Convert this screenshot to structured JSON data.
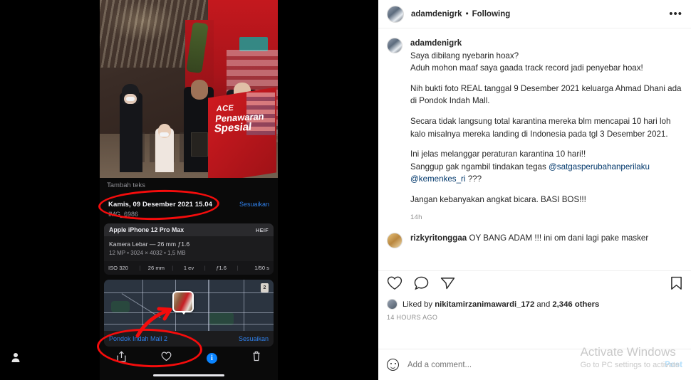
{
  "left_panel": {
    "photo": {
      "alt_description": "Family wearing masks standing inside a shopping mall",
      "banner_logo": "ACE",
      "banner_line1": "Penawaran",
      "banner_line2": "Spesial"
    },
    "add_text_label": "Tambah teks",
    "date_line": "Kamis, 09 Desember 2021 15.04",
    "filename": "IMG_6986",
    "adjust_label": "Sesuaikan",
    "exif": {
      "device": "Apple iPhone 12 Pro Max",
      "format": "HEIF",
      "lens_line": "Kamera Lebar — 26 mm ƒ1.6",
      "spec_line": "12 MP • 3024 × 4032 • 1,5 MB",
      "stats": [
        "ISO 320",
        "26 mm",
        "1 ev",
        "ƒ1.6",
        "1/50 s"
      ]
    },
    "map": {
      "place_name": "Pondok Indah Mall 2",
      "adjust_label": "Sesuaikan",
      "badge_label": "2"
    },
    "toolbar": {
      "share_icon": "share-icon",
      "favorite_icon": "heart-icon",
      "info_icon": "info-icon",
      "info_label": "i",
      "delete_icon": "trash-icon"
    },
    "profile_icon": "person-icon",
    "annotations": [
      {
        "name": "red-circle-on-date",
        "color": "#f50c0c"
      },
      {
        "name": "red-circle-on-location",
        "color": "#f50c0c"
      }
    ]
  },
  "instagram": {
    "header": {
      "avatar": "user-avatar",
      "username": "adamdenigrk",
      "separator": "•",
      "follow_state": "Following",
      "more_icon": "more-options-icon"
    },
    "caption": {
      "username": "adamdenigrk",
      "lines": [
        "Saya dibilang nyebarin hoax?",
        "Aduh mohon maaf saya gaada track record jadi penyebar hoax!",
        "",
        "Nih bukti foto REAL tanggal 9 Desember 2021 keluarga Ahmad Dhani ada di Pondok Indah Mall.",
        "",
        "Secara tidak langsung total karantina mereka blm mencapai 10 hari loh kalo misalnya mereka landing di Indonesia pada tgl 3 Desember 2021.",
        "",
        "Ini jelas melanggar peraturan karantina 10 hari!!",
        "Sanggup gak ngambil tindakan tegas @satgasperubahanperilaku @kemenkes_ri ???",
        "",
        "Jangan kebanyakan angkat bicara. BASI BOS!!!"
      ],
      "mentions": [
        "@satgasperubahanperilaku",
        "@kemenkes_ri"
      ],
      "timestamp": "14h"
    },
    "comment": {
      "username": "rizkyritonggaa",
      "text": "OY BANG ADAM !!! ini om dani lagi pake masker"
    },
    "actions": {
      "like_icon": "heart-icon",
      "comment_icon": "comment-icon",
      "share_icon": "share-icon",
      "save_icon": "bookmark-icon"
    },
    "likes": {
      "prefix": "Liked by",
      "top_liker": "nikitamirzanimawardi_172",
      "middle": "and",
      "others_count": "2,346",
      "suffix": "others"
    },
    "post_time": "14 HOURS AGO",
    "add_comment": {
      "emoji_icon": "emoji-icon",
      "placeholder": "Add a comment...",
      "post_label": "Post"
    }
  },
  "windows_watermark": {
    "line1": "Activate Windows",
    "line2": "Go to PC settings to activate"
  }
}
